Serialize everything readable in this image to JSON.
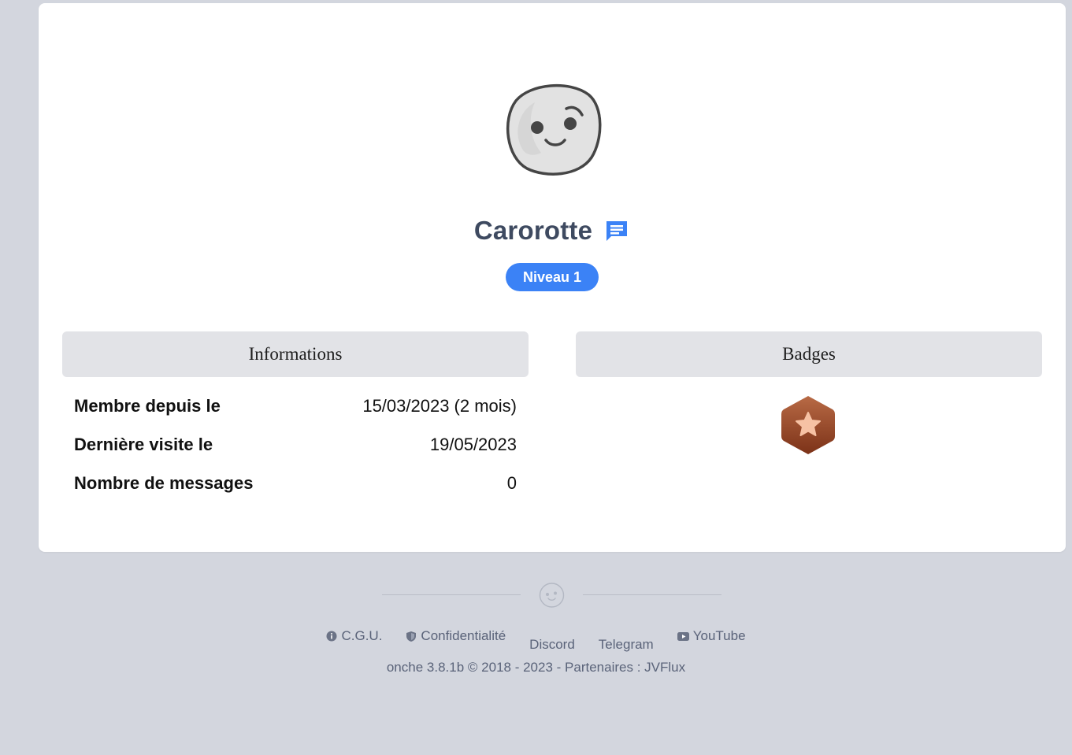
{
  "profile": {
    "username": "Carorotte",
    "level_label": "Niveau 1"
  },
  "sections": {
    "informations_title": "Informations",
    "badges_title": "Badges"
  },
  "info_rows": [
    {
      "label": "Membre depuis le",
      "value": "15/03/2023 (2 mois)"
    },
    {
      "label": "Dernière visite le",
      "value": "19/05/2023"
    },
    {
      "label": "Nombre de messages",
      "value": "0"
    }
  ],
  "footer": {
    "links": {
      "cgu": "C.G.U.",
      "privacy": "Confidentialité",
      "discord": "Discord",
      "telegram": "Telegram",
      "youtube": "YouTube"
    },
    "version": "onche 3.8.1b",
    "copyright_symbol": "©",
    "years": "2018 - 2023",
    "separator": "-",
    "partners_label": "Partenaires :",
    "partner_name": "JVFlux"
  },
  "colors": {
    "page_bg": "#d3d6de",
    "card_bg": "#ffffff",
    "accent_blue": "#3b82f6",
    "username": "#3e4a60",
    "badge_bronze": "#a0502e"
  },
  "icons": {
    "avatar": "smiley-face-icon",
    "message": "chat-message-icon",
    "badge": "bronze-star-badge-icon",
    "cgu": "info-circle-icon",
    "privacy": "shield-icon",
    "youtube": "youtube-icon",
    "footer_logo": "smiley-logo-icon"
  }
}
